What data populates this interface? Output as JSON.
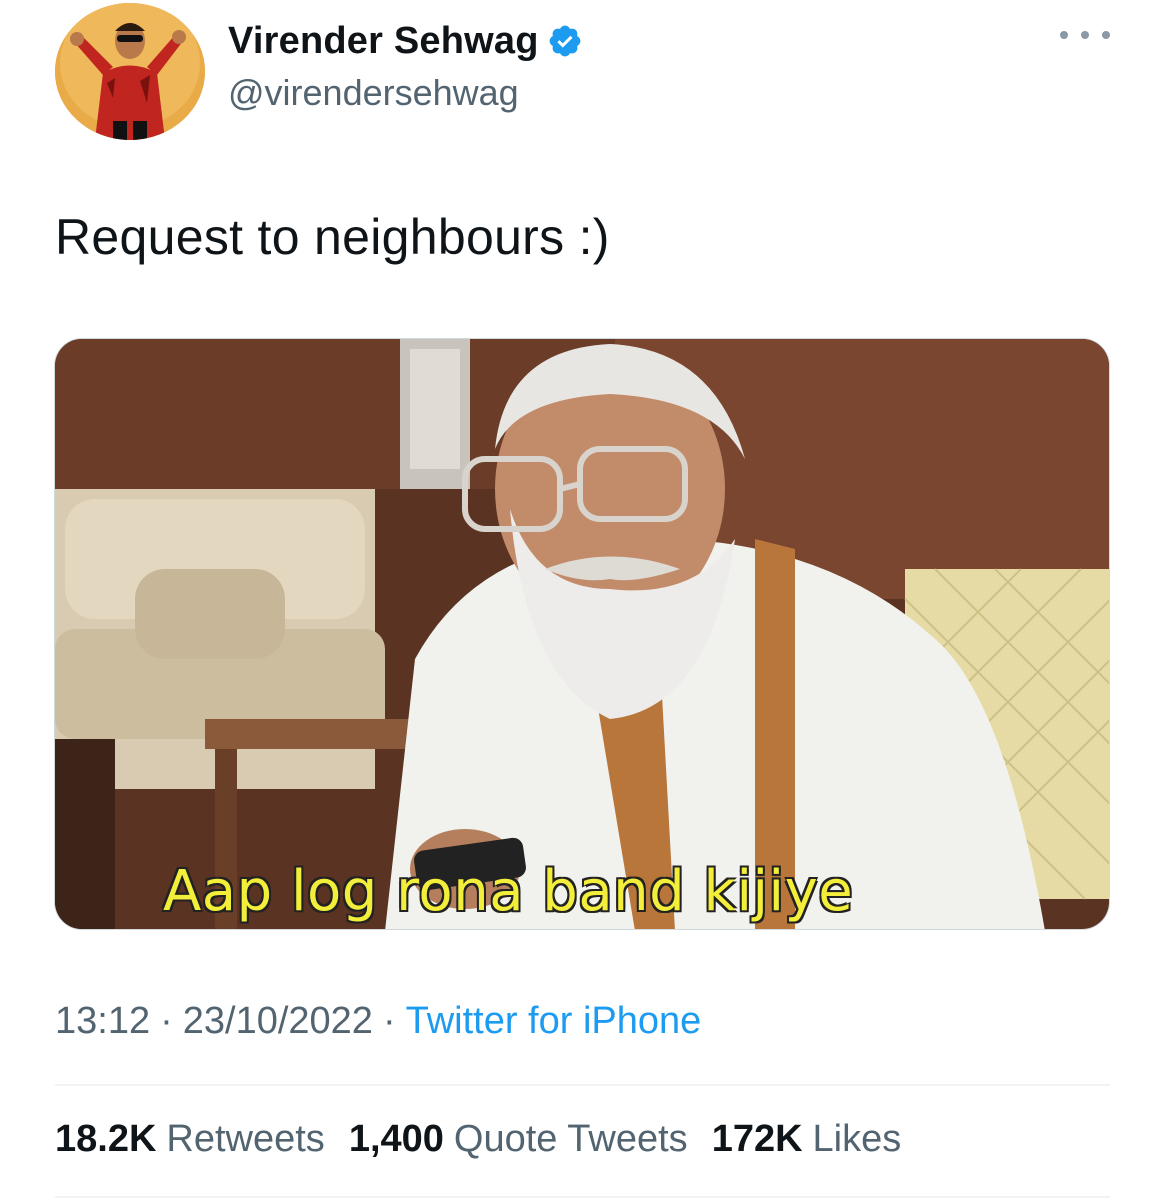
{
  "user": {
    "display_name": "Virender Sehwag",
    "handle": "@virendersehwag",
    "verified": true,
    "verified_color": "#1d9bf0"
  },
  "tweet": {
    "text": "Request to neighbours :)",
    "media_caption": "Aap log rona band kijiye"
  },
  "meta": {
    "time": "13:12",
    "separator": "·",
    "date": "23/10/2022",
    "source": "Twitter for iPhone"
  },
  "stats": [
    {
      "count": "18.2K",
      "label": "Retweets"
    },
    {
      "count": "1,400",
      "label": "Quote Tweets"
    },
    {
      "count": "172K",
      "label": "Likes"
    }
  ],
  "colors": {
    "accent": "#1d9bf0",
    "secondary_text": "#536471",
    "primary_text": "#0f1419",
    "caption": "#f2ee3a"
  },
  "icons": {
    "verified": "verified-badge-icon",
    "more": "more-options-icon"
  }
}
